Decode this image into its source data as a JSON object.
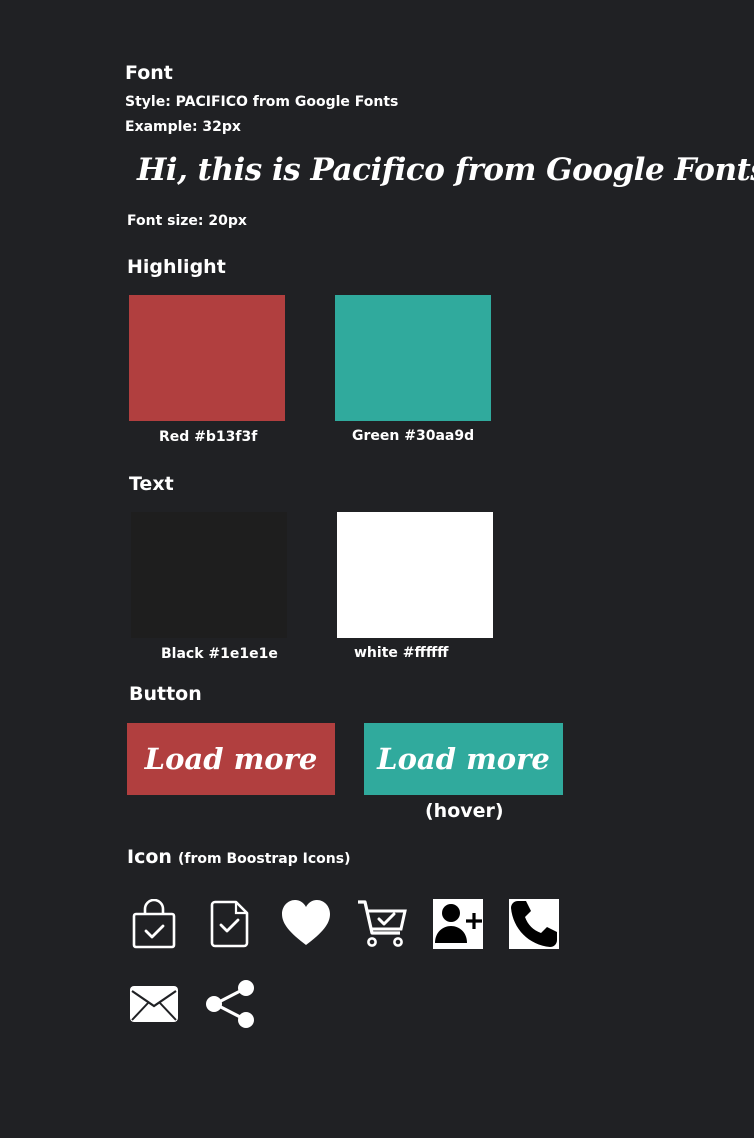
{
  "font": {
    "heading": "Font",
    "style_line": "Style: PACIFICO from Google Fonts",
    "example_line": "Example: 32px",
    "example_text": "Hi, this is Pacifico from Google Fonts",
    "size_line": "Font size: 20px"
  },
  "highlight": {
    "heading": "Highlight",
    "swatches": [
      {
        "label": "Red #b13f3f",
        "color": "#b13f3f"
      },
      {
        "label": "Green #30aa9d",
        "color": "#30aa9d"
      }
    ]
  },
  "text_colors": {
    "heading": "Text",
    "swatches": [
      {
        "label": "Black #1e1e1e",
        "color": "#1e1e1e"
      },
      {
        "label": "white #ffffff",
        "color": "#ffffff"
      }
    ]
  },
  "button": {
    "heading": "Button",
    "label": "Load more",
    "normal_color": "#b13f3f",
    "hover_color": "#30aa9d",
    "hover_caption": "(hover)"
  },
  "icon_section": {
    "heading": "Icon",
    "source_note": "(from Boostrap Icons)",
    "icons": [
      "bag-check-icon",
      "file-check-icon",
      "heart-icon",
      "cart-check-icon",
      "person-plus-icon",
      "telephone-icon",
      "envelope-icon",
      "share-icon"
    ]
  }
}
